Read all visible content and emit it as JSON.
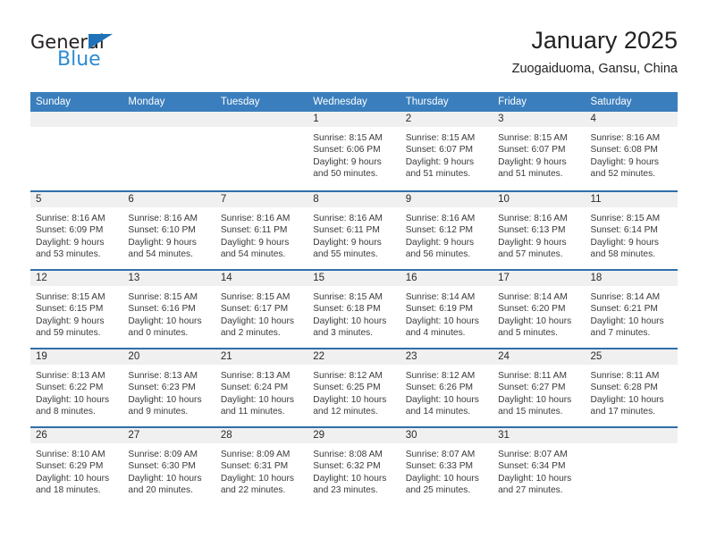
{
  "logo": {
    "primary_text": "General",
    "secondary_text": "Blue",
    "triangle_icon": "triangle-icon",
    "primary_color": "#231f20",
    "secondary_color": "#2e8bd4",
    "triangle_color": "#1f72b8"
  },
  "header": {
    "title": "January 2025",
    "subtitle": "Zuogaiduoma, Gansu, China"
  },
  "theme": {
    "header_blue": "#3a7ebd",
    "week_divider_blue": "#2f6fab",
    "daynum_band": "#f0f0f0",
    "text": "#3a3a3a"
  },
  "weekdays": [
    "Sunday",
    "Monday",
    "Tuesday",
    "Wednesday",
    "Thursday",
    "Friday",
    "Saturday"
  ],
  "weeks": [
    [
      {
        "day": "",
        "lines": []
      },
      {
        "day": "",
        "lines": []
      },
      {
        "day": "",
        "lines": []
      },
      {
        "day": "1",
        "lines": [
          "Sunrise: 8:15 AM",
          "Sunset: 6:06 PM",
          "Daylight: 9 hours",
          "and 50 minutes."
        ]
      },
      {
        "day": "2",
        "lines": [
          "Sunrise: 8:15 AM",
          "Sunset: 6:07 PM",
          "Daylight: 9 hours",
          "and 51 minutes."
        ]
      },
      {
        "day": "3",
        "lines": [
          "Sunrise: 8:15 AM",
          "Sunset: 6:07 PM",
          "Daylight: 9 hours",
          "and 51 minutes."
        ]
      },
      {
        "day": "4",
        "lines": [
          "Sunrise: 8:16 AM",
          "Sunset: 6:08 PM",
          "Daylight: 9 hours",
          "and 52 minutes."
        ]
      }
    ],
    [
      {
        "day": "5",
        "lines": [
          "Sunrise: 8:16 AM",
          "Sunset: 6:09 PM",
          "Daylight: 9 hours",
          "and 53 minutes."
        ]
      },
      {
        "day": "6",
        "lines": [
          "Sunrise: 8:16 AM",
          "Sunset: 6:10 PM",
          "Daylight: 9 hours",
          "and 54 minutes."
        ]
      },
      {
        "day": "7",
        "lines": [
          "Sunrise: 8:16 AM",
          "Sunset: 6:11 PM",
          "Daylight: 9 hours",
          "and 54 minutes."
        ]
      },
      {
        "day": "8",
        "lines": [
          "Sunrise: 8:16 AM",
          "Sunset: 6:11 PM",
          "Daylight: 9 hours",
          "and 55 minutes."
        ]
      },
      {
        "day": "9",
        "lines": [
          "Sunrise: 8:16 AM",
          "Sunset: 6:12 PM",
          "Daylight: 9 hours",
          "and 56 minutes."
        ]
      },
      {
        "day": "10",
        "lines": [
          "Sunrise: 8:16 AM",
          "Sunset: 6:13 PM",
          "Daylight: 9 hours",
          "and 57 minutes."
        ]
      },
      {
        "day": "11",
        "lines": [
          "Sunrise: 8:15 AM",
          "Sunset: 6:14 PM",
          "Daylight: 9 hours",
          "and 58 minutes."
        ]
      }
    ],
    [
      {
        "day": "12",
        "lines": [
          "Sunrise: 8:15 AM",
          "Sunset: 6:15 PM",
          "Daylight: 9 hours",
          "and 59 minutes."
        ]
      },
      {
        "day": "13",
        "lines": [
          "Sunrise: 8:15 AM",
          "Sunset: 6:16 PM",
          "Daylight: 10 hours",
          "and 0 minutes."
        ]
      },
      {
        "day": "14",
        "lines": [
          "Sunrise: 8:15 AM",
          "Sunset: 6:17 PM",
          "Daylight: 10 hours",
          "and 2 minutes."
        ]
      },
      {
        "day": "15",
        "lines": [
          "Sunrise: 8:15 AM",
          "Sunset: 6:18 PM",
          "Daylight: 10 hours",
          "and 3 minutes."
        ]
      },
      {
        "day": "16",
        "lines": [
          "Sunrise: 8:14 AM",
          "Sunset: 6:19 PM",
          "Daylight: 10 hours",
          "and 4 minutes."
        ]
      },
      {
        "day": "17",
        "lines": [
          "Sunrise: 8:14 AM",
          "Sunset: 6:20 PM",
          "Daylight: 10 hours",
          "and 5 minutes."
        ]
      },
      {
        "day": "18",
        "lines": [
          "Sunrise: 8:14 AM",
          "Sunset: 6:21 PM",
          "Daylight: 10 hours",
          "and 7 minutes."
        ]
      }
    ],
    [
      {
        "day": "19",
        "lines": [
          "Sunrise: 8:13 AM",
          "Sunset: 6:22 PM",
          "Daylight: 10 hours",
          "and 8 minutes."
        ]
      },
      {
        "day": "20",
        "lines": [
          "Sunrise: 8:13 AM",
          "Sunset: 6:23 PM",
          "Daylight: 10 hours",
          "and 9 minutes."
        ]
      },
      {
        "day": "21",
        "lines": [
          "Sunrise: 8:13 AM",
          "Sunset: 6:24 PM",
          "Daylight: 10 hours",
          "and 11 minutes."
        ]
      },
      {
        "day": "22",
        "lines": [
          "Sunrise: 8:12 AM",
          "Sunset: 6:25 PM",
          "Daylight: 10 hours",
          "and 12 minutes."
        ]
      },
      {
        "day": "23",
        "lines": [
          "Sunrise: 8:12 AM",
          "Sunset: 6:26 PM",
          "Daylight: 10 hours",
          "and 14 minutes."
        ]
      },
      {
        "day": "24",
        "lines": [
          "Sunrise: 8:11 AM",
          "Sunset: 6:27 PM",
          "Daylight: 10 hours",
          "and 15 minutes."
        ]
      },
      {
        "day": "25",
        "lines": [
          "Sunrise: 8:11 AM",
          "Sunset: 6:28 PM",
          "Daylight: 10 hours",
          "and 17 minutes."
        ]
      }
    ],
    [
      {
        "day": "26",
        "lines": [
          "Sunrise: 8:10 AM",
          "Sunset: 6:29 PM",
          "Daylight: 10 hours",
          "and 18 minutes."
        ]
      },
      {
        "day": "27",
        "lines": [
          "Sunrise: 8:09 AM",
          "Sunset: 6:30 PM",
          "Daylight: 10 hours",
          "and 20 minutes."
        ]
      },
      {
        "day": "28",
        "lines": [
          "Sunrise: 8:09 AM",
          "Sunset: 6:31 PM",
          "Daylight: 10 hours",
          "and 22 minutes."
        ]
      },
      {
        "day": "29",
        "lines": [
          "Sunrise: 8:08 AM",
          "Sunset: 6:32 PM",
          "Daylight: 10 hours",
          "and 23 minutes."
        ]
      },
      {
        "day": "30",
        "lines": [
          "Sunrise: 8:07 AM",
          "Sunset: 6:33 PM",
          "Daylight: 10 hours",
          "and 25 minutes."
        ]
      },
      {
        "day": "31",
        "lines": [
          "Sunrise: 8:07 AM",
          "Sunset: 6:34 PM",
          "Daylight: 10 hours",
          "and 27 minutes."
        ]
      },
      {
        "day": "",
        "lines": []
      }
    ]
  ]
}
